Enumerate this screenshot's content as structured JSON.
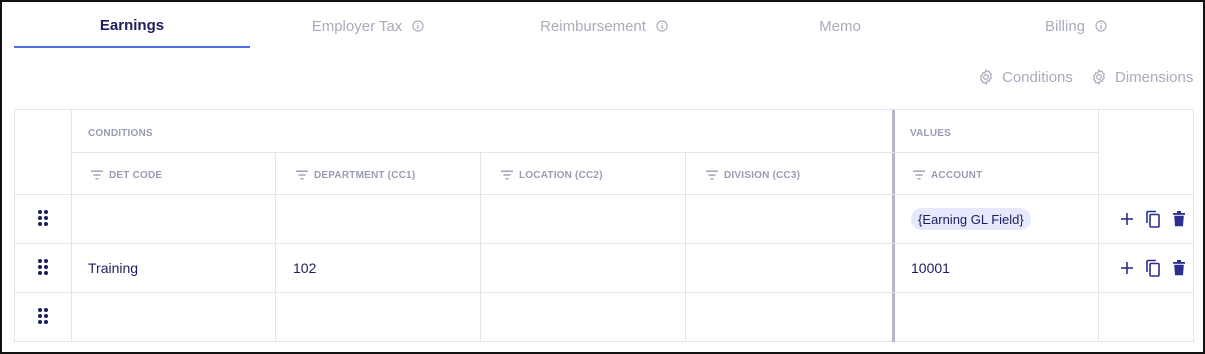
{
  "tabs": [
    {
      "label": "Earnings",
      "active": true,
      "info": false
    },
    {
      "label": "Employer Tax",
      "active": false,
      "info": true
    },
    {
      "label": "Reimbursement",
      "active": false,
      "info": true
    },
    {
      "label": "Memo",
      "active": false,
      "info": false
    },
    {
      "label": "Billing",
      "active": false,
      "info": true
    }
  ],
  "toolbar": {
    "conditions_label": "Conditions",
    "dimensions_label": "Dimensions"
  },
  "table": {
    "groups": {
      "conditions": "CONDITIONS",
      "values": "VALUES"
    },
    "columns": [
      "DET CODE",
      "DEPARTMENT (CC1)",
      "LOCATION (CC2)",
      "DIVISION (CC3)",
      "ACCOUNT"
    ],
    "rows": [
      {
        "det_code": "",
        "department": "",
        "location": "",
        "division": "",
        "account": "{Earning GL Field}",
        "account_is_chip": true
      },
      {
        "det_code": "Training",
        "department": "102",
        "location": "",
        "division": "",
        "account": "10001",
        "account_is_chip": false
      },
      {
        "det_code": "",
        "department": "",
        "location": "",
        "division": "",
        "account": "",
        "account_is_chip": false
      }
    ]
  },
  "icons": {
    "tab_info": "info-circle-icon",
    "toolbar": "gear-icon",
    "column": "filter-lines-icon",
    "row_handle": "drag-dots-icon",
    "row_actions": [
      "plus-icon",
      "copy-icon",
      "trash-icon"
    ]
  },
  "colors": {
    "active_tab_text": "#1c1e5e",
    "active_tab_underline": "#4f6de6",
    "inactive_text": "#a9abbe",
    "chip_background": "#e6e9fb",
    "action_icons": "#2c2f8f"
  }
}
